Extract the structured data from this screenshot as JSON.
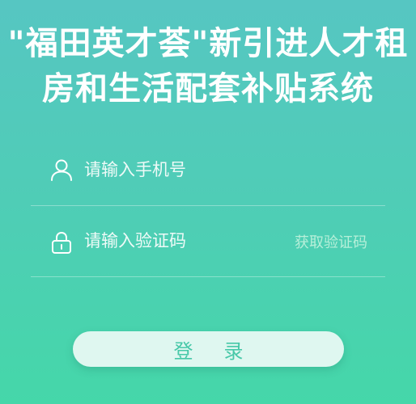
{
  "title": {
    "line1": "\"福田英才荟\"新引进人才租",
    "line2": "房和生活配套补贴系统"
  },
  "phone": {
    "icon": "user-icon",
    "placeholder": "请输入手机号"
  },
  "code": {
    "icon": "lock-icon",
    "placeholder": "请输入验证码",
    "get_code_label": "获取验证码"
  },
  "login": {
    "label": "登录"
  },
  "colors": {
    "background_top": "#56c6c2",
    "background_bottom": "#45d7a9",
    "button_bg": "#dff7f0",
    "button_text": "#47c8a8",
    "get_code_text": "#b6efd9"
  }
}
